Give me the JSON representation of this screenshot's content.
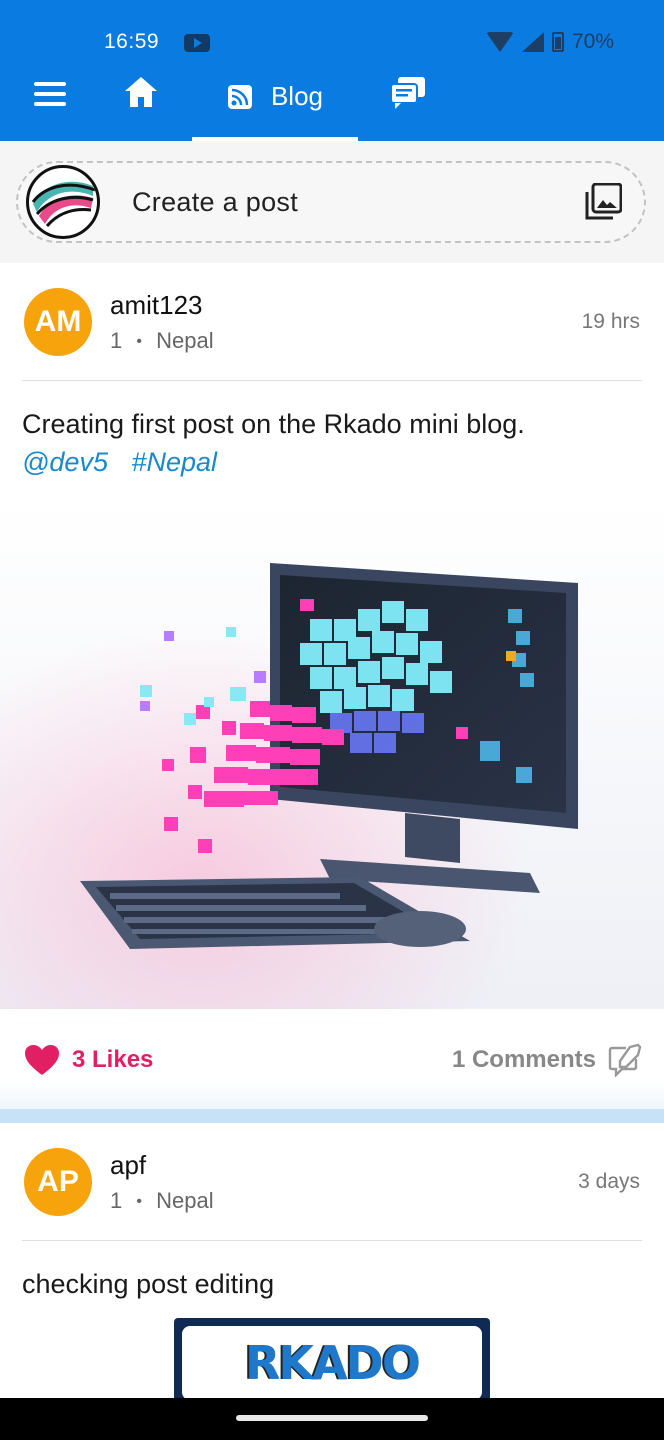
{
  "status_bar": {
    "time": "16:59",
    "battery": "70%"
  },
  "toolbar": {
    "blog_tab_label": "Blog"
  },
  "create_post": {
    "label": "Create a post"
  },
  "posts": [
    {
      "avatar_initials": "AM",
      "username": "amit123",
      "meta_count": "1",
      "meta_separator": "•",
      "location": "Nepal",
      "time": "19 hrs",
      "text": "Creating first post on the Rkado mini blog.",
      "mentions": [
        "@dev5",
        "#Nepal"
      ],
      "likes": "3 Likes",
      "comments": "1 Comments"
    },
    {
      "avatar_initials": "AP",
      "username": "apf",
      "meta_count": "1",
      "meta_separator": "•",
      "location": "Nepal",
      "time": "3 days",
      "text": "checking post editing",
      "logo_text": "RKADO"
    }
  ],
  "colors": {
    "primary": "#0a7be0",
    "avatar": "#f7a30c",
    "like": "#e21f63",
    "link": "#1a88cf",
    "separator": "#c7e2f6"
  }
}
